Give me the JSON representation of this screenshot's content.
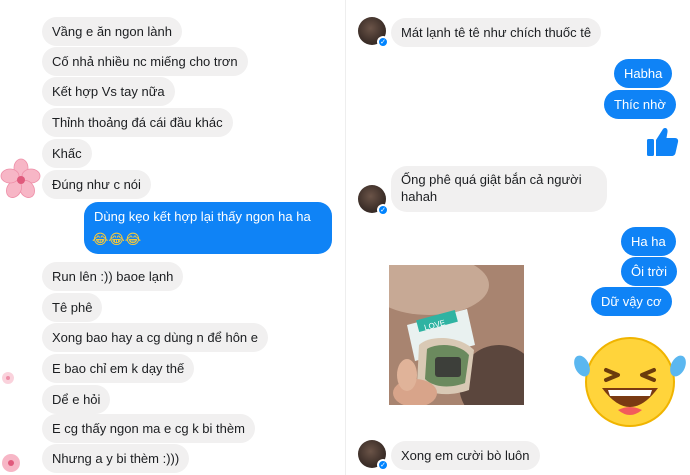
{
  "left": {
    "incoming": [
      "Vầng e ăn ngon lành",
      "Cố nhả nhiều nc miếng cho trơn",
      "Kết hợp Vs tay nữa",
      "Thỉnh thoảng đá cái đầu khác",
      "Khấc",
      "Đúng như c nói"
    ],
    "outgoing_text": "Dùng kẹo kết hợp lại thấy ngon ha ha",
    "outgoing_emojis": "😂😂😂",
    "incoming2": [
      "Run lên :)) baoe lạnh",
      "Tê phê",
      "Xong bao hay a cg dùng n để hôn e",
      "E bao chỉ em k dạy thế",
      "Dể e hỏi",
      "E cg thấy ngon ma e cg k bi thèm",
      "Nhưng a y bi thèm :)))"
    ]
  },
  "right": {
    "msg1": "Mát lạnh tê tê như chích thuốc tê",
    "out1": [
      "Habha",
      "Thíc nhờ"
    ],
    "msg2": [
      "Ống phê quá giật bắn cả người",
      "hahah"
    ],
    "out2": [
      "Ha ha",
      "Ôi trời",
      "Dữ vậy cơ"
    ],
    "photo_package_text": "LOVE",
    "msg3": "Xong em cười bò luôn"
  },
  "icons": [
    "thumbs-up-icon",
    "laughing-emoji-icon",
    "cherry-blossom-icon",
    "messenger-badge-icon"
  ],
  "colors": {
    "outgoing": "#0f83f6",
    "incoming": "#f1f0f0",
    "accent": "#0084ff"
  }
}
